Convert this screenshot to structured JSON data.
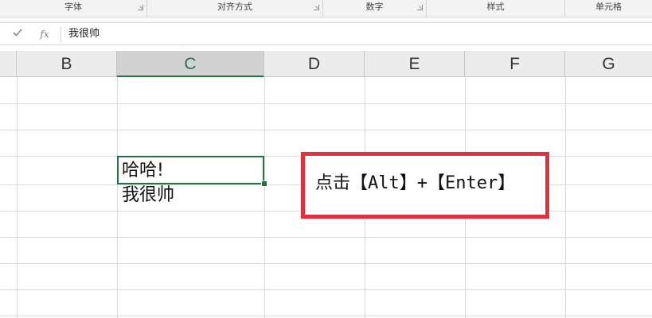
{
  "ribbon": {
    "groups": [
      {
        "label": "字体"
      },
      {
        "label": "对齐方式"
      },
      {
        "label": "数字"
      },
      {
        "label": "样式"
      },
      {
        "label": "单元格"
      }
    ]
  },
  "formula_bar": {
    "cancel_icon": "checkmark-icon",
    "fx_label": "fx",
    "value": "我很帅"
  },
  "columns": [
    "B",
    "C",
    "D",
    "E",
    "F",
    "G"
  ],
  "active_column": "C",
  "active_cell": {
    "lines": [
      "哈哈!",
      "我很帅"
    ]
  },
  "annotation": {
    "text": "点击【Alt】+【Enter】",
    "border_color": "#e0313f"
  },
  "colors": {
    "accent": "#217346"
  }
}
